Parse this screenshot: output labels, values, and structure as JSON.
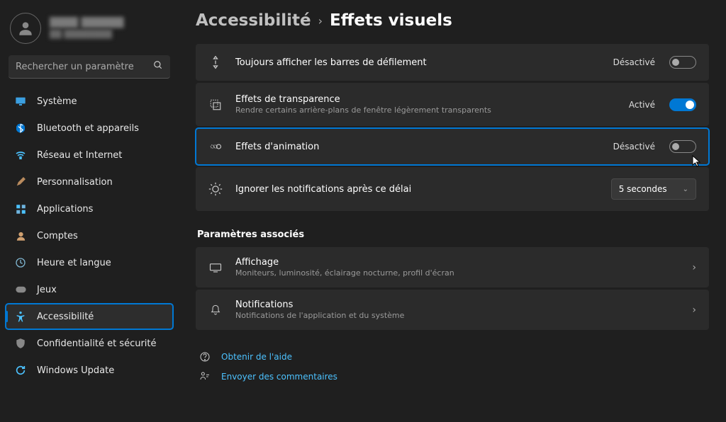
{
  "profile": {
    "name": "████ ██████",
    "sub": "██ ████████"
  },
  "search": {
    "placeholder": "Rechercher un paramètre"
  },
  "nav": [
    {
      "label": "Système",
      "icon": "💻",
      "color": "#4cc2ff"
    },
    {
      "label": "Bluetooth et appareils",
      "icon": "bt"
    },
    {
      "label": "Réseau et Internet",
      "icon": "wifi"
    },
    {
      "label": "Personnalisation",
      "icon": "🖌️"
    },
    {
      "label": "Applications",
      "icon": "apps"
    },
    {
      "label": "Comptes",
      "icon": "👤"
    },
    {
      "label": "Heure et langue",
      "icon": "clock"
    },
    {
      "label": "Jeux",
      "icon": "🎮"
    },
    {
      "label": "Accessibilité",
      "icon": "access",
      "active": true
    },
    {
      "label": "Confidentialité et sécurité",
      "icon": "🛡️"
    },
    {
      "label": "Windows Update",
      "icon": "update"
    }
  ],
  "breadcrumb": {
    "parent": "Accessibilité",
    "current": "Effets visuels"
  },
  "settings": {
    "scrollbars": {
      "title": "Toujours afficher les barres de défilement",
      "state": "Désactivé",
      "on": false
    },
    "transparency": {
      "title": "Effets de transparence",
      "sub": "Rendre certains arrière-plans de fenêtre légèrement transparents",
      "state": "Activé",
      "on": true
    },
    "animation": {
      "title": "Effets d'animation",
      "state": "Désactivé",
      "on": false
    },
    "notifications_delay": {
      "title": "Ignorer les notifications après ce délai",
      "value": "5 secondes"
    }
  },
  "related_title": "Paramètres associés",
  "related": {
    "display": {
      "title": "Affichage",
      "sub": "Moniteurs, luminosité, éclairage nocturne, profil d'écran"
    },
    "notifications": {
      "title": "Notifications",
      "sub": "Notifications de l'application et du système"
    }
  },
  "footer": {
    "help": "Obtenir de l'aide",
    "feedback": "Envoyer des commentaires"
  }
}
